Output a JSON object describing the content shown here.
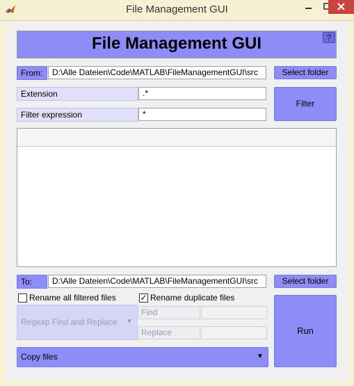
{
  "window": {
    "title": "File Management GUI",
    "controls": {
      "minimize": "–",
      "maximize": "☐",
      "close": "✕"
    }
  },
  "header": {
    "title": "File Management GUI",
    "help_label": "?"
  },
  "source": {
    "label": "From:",
    "path": "D:\\Alle Dateien\\Code\\MATLAB\\FileManagementGUI\\src",
    "select_label": "Select folder"
  },
  "filter": {
    "extension_label": "Extension",
    "extension_value": ".*",
    "expression_label": "Filter expression",
    "expression_value": "*",
    "button_label": "Filter"
  },
  "file_list": {
    "items": []
  },
  "destination": {
    "label": "To:",
    "path": "D:\\Alle Dateien\\Code\\MATLAB\\FileManagementGUI\\src",
    "select_label": "Select folder"
  },
  "options": {
    "rename_all_label": "Rename all filtered files",
    "rename_all_checked": false,
    "rename_duplicates_label": "Rename duplicate files",
    "rename_duplicates_checked": true,
    "check_mark": "✓"
  },
  "regexp": {
    "selected": "Regexp Find and Replace",
    "enabled": false,
    "find_label": "Find",
    "find_value": "",
    "replace_label": "Replace",
    "replace_value": ""
  },
  "operation": {
    "selected": "Copy files",
    "arrow": "▼"
  },
  "run": {
    "label": "Run"
  },
  "colors": {
    "accent": "#8e8df7",
    "accent_light": "#e0e0fb",
    "title_bar": "#f7f1d4",
    "close": "#c7453c"
  }
}
